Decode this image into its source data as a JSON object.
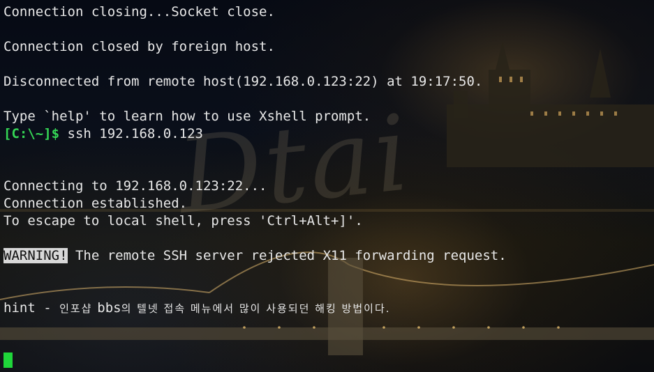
{
  "watermark_text": "Dtai",
  "lines": {
    "closing": "Connection closing...Socket close.",
    "closed": "Connection closed by foreign host.",
    "disconnected": "Disconnected from remote host(192.168.0.123:22) at 19:17:50.",
    "type_help": "Type `help' to learn how to use Xshell prompt.",
    "prompt_tag": "[C:\\~]$",
    "prompt_command": " ssh 192.168.0.123",
    "connecting": "Connecting to 192.168.0.123:22...",
    "established": "Connection established.",
    "escape": "To escape to local shell, press 'Ctrl+Alt+]'.",
    "warning_tag": "WARNING!",
    "warning_text": " The remote SSH server rejected X11 forwarding request.",
    "hint_prefix": "hint - ",
    "hint_korean": "인포샵 ",
    "hint_bbs": "bbs",
    "hint_rest": "의 텔넷 접속 메뉴에서 많이 사용되던 해킹 방법이다."
  },
  "colors": {
    "prompt_green": "#35d655",
    "cursor_green": "#1fd63a",
    "text": "#e8e8e8"
  }
}
